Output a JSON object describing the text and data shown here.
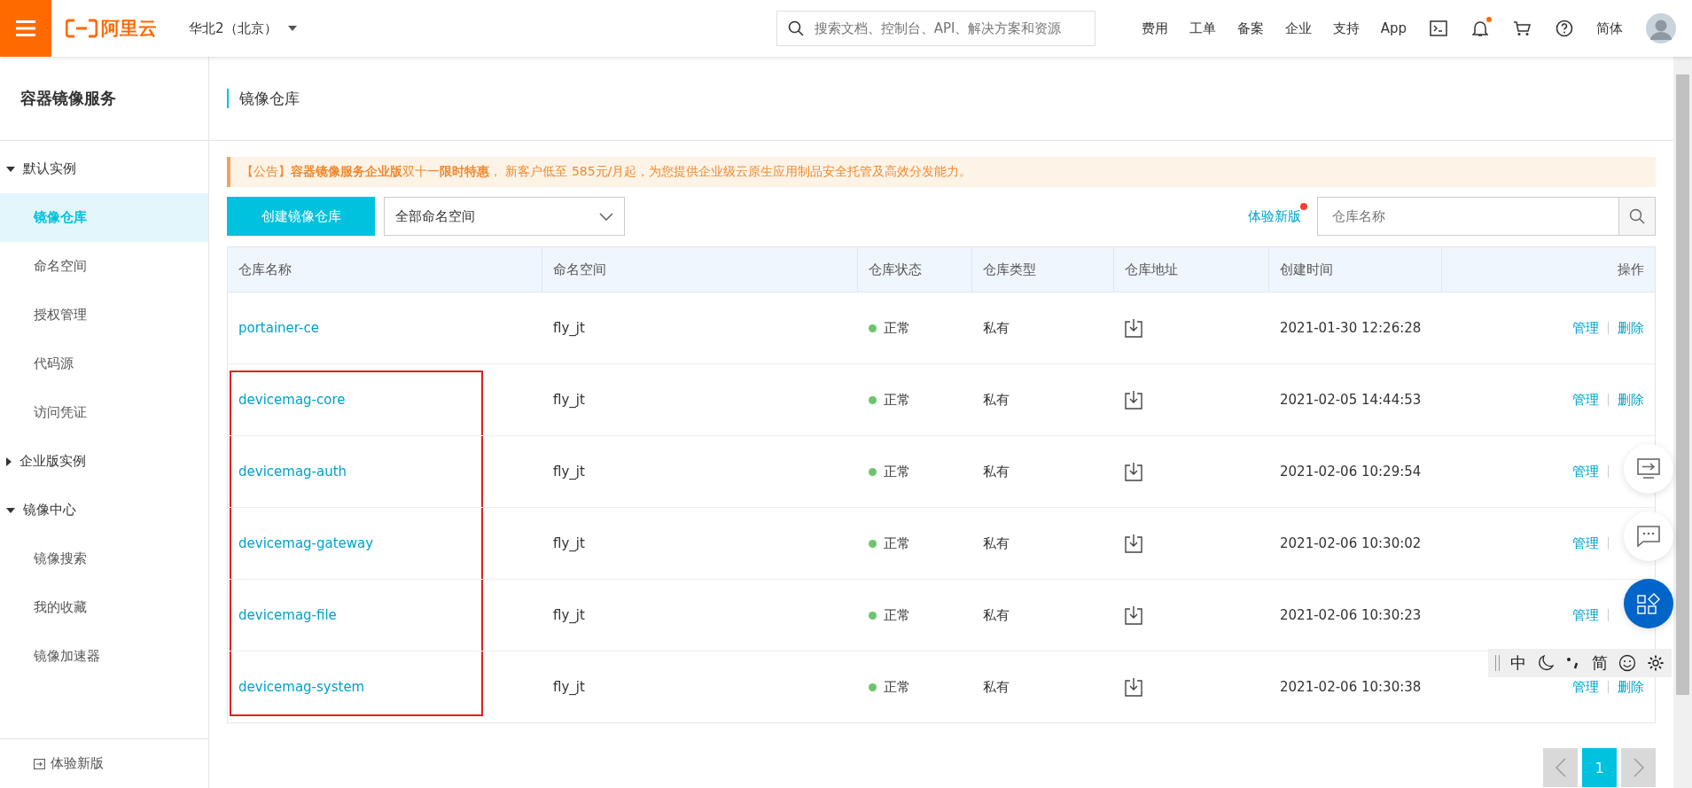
{
  "topbar": {
    "brand": "阿里云",
    "region": "华北2（北京）",
    "search": {
      "placeholder": "搜索文档、控制台、API、解决方案和资源"
    },
    "links": [
      "费用",
      "工单",
      "备案",
      "企业",
      "支持",
      "App"
    ],
    "notification_dot": true,
    "language": "简体"
  },
  "sidebar": {
    "title": "容器镜像服务",
    "groups": [
      {
        "label": "默认实例",
        "expanded": true,
        "children": [
          {
            "label": "镜像仓库",
            "selected": true
          },
          {
            "label": "命名空间",
            "selected": false
          },
          {
            "label": "授权管理",
            "selected": false
          },
          {
            "label": "代码源",
            "selected": false
          },
          {
            "label": "访问凭证",
            "selected": false
          }
        ]
      },
      {
        "label": "企业版实例",
        "expanded": false
      },
      {
        "label": "镜像中心",
        "expanded": true,
        "children": [
          {
            "label": "镜像搜索",
            "selected": false
          },
          {
            "label": "我的收藏",
            "selected": false
          },
          {
            "label": "镜像加速器",
            "selected": false
          }
        ]
      }
    ],
    "footer": "体验新版"
  },
  "page_title": "镜像仓库",
  "notice": "【公告】**容器镜像服务企业版**双十一**限时特惠**， 新客户低至 585元/月起，为您提供企业级云原生应用制品安全托管及高效分发能力。",
  "toolbar": {
    "create_button": "创建镜像仓库",
    "namespace_select": "全部命名空间",
    "new_version_link": "体验新版",
    "new_version_dot": true,
    "search": {
      "placeholder": "仓库名称"
    }
  },
  "table": {
    "columns": [
      "仓库名称",
      "命名空间",
      "仓库状态",
      "仓库类型",
      "仓库地址",
      "创建时间",
      "操作"
    ],
    "rows": [
      {
        "name": "portainer-ce",
        "namespace": "fly_jt",
        "status": "正常",
        "color": "#6cc56c",
        "type": "私有",
        "created": "2021-01-30 12:26:28",
        "manage": "管理",
        "delete": "删除",
        "highlighted": false
      },
      {
        "name": "devicemag-core",
        "namespace": "fly_jt",
        "status": "正常",
        "color": "#6cc56c",
        "type": "私有",
        "created": "2021-02-05 14:44:53",
        "manage": "管理",
        "delete": "删除",
        "highlighted": true
      },
      {
        "name": "devicemag-auth",
        "namespace": "fly_jt",
        "status": "正常",
        "color": "#6cc56c",
        "type": "私有",
        "created": "2021-02-06 10:29:54",
        "manage": "管理",
        "highlighted": true
      },
      {
        "name": "devicemag-gateway",
        "namespace": "fly_jt",
        "status": "正常",
        "color": "#6cc56c",
        "type": "私有",
        "created": "2021-02-06 10:30:02",
        "manage": "管理",
        "highlighted": true
      },
      {
        "name": "devicemag-file",
        "namespace": "fly_jt",
        "status": "正常",
        "color": "#6cc56c",
        "type": "私有",
        "created": "2021-02-06 10:30:23",
        "manage": "管理",
        "highlighted": true
      },
      {
        "name": "devicemag-system",
        "namespace": "fly_jt",
        "status": "正常",
        "color": "#6cc56c",
        "type": "私有",
        "created": "2021-02-06 10:30:38",
        "manage": "管理",
        "delete": "删除",
        "highlighted": true
      }
    ]
  },
  "pagination": {
    "pages": [
      {
        "label": "1",
        "selected": true
      }
    ]
  },
  "ime_bar": [
    "中",
    "简"
  ]
}
